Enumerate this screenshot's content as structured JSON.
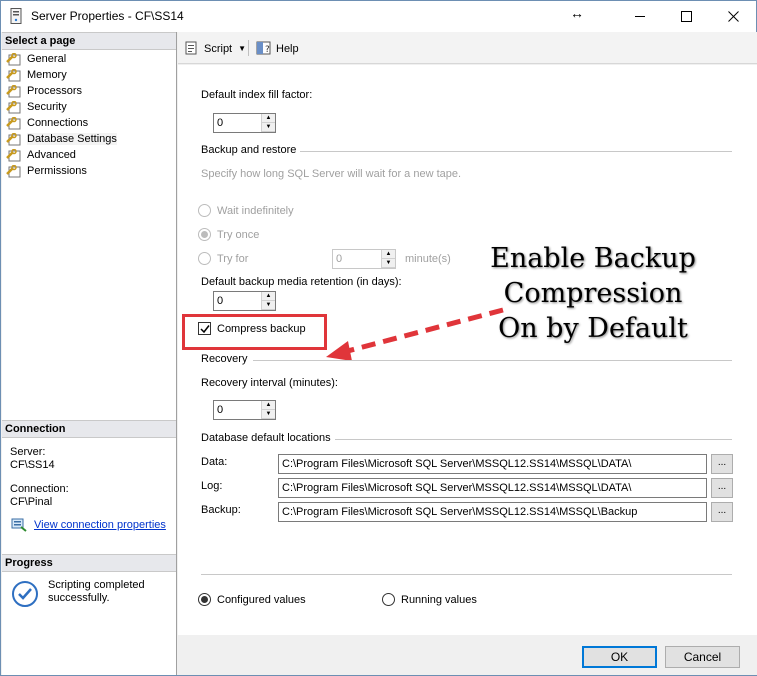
{
  "window": {
    "title": "Server Properties - CF\\SS14"
  },
  "left_pane": {
    "select_header": "Select a page",
    "pages": [
      {
        "label": "General"
      },
      {
        "label": "Memory"
      },
      {
        "label": "Processors"
      },
      {
        "label": "Security"
      },
      {
        "label": "Connections"
      },
      {
        "label": "Database Settings"
      },
      {
        "label": "Advanced"
      },
      {
        "label": "Permissions"
      }
    ],
    "connection_header": "Connection",
    "server_label": "Server:",
    "server_value": "CF\\SS14",
    "connection_label": "Connection:",
    "connection_value": "CF\\Pinal",
    "view_connection_link": "View connection properties",
    "progress_header": "Progress",
    "progress_line1": "Scripting completed",
    "progress_line2": "successfully."
  },
  "toolbar": {
    "script_label": "Script",
    "help_label": "Help"
  },
  "settings": {
    "fill_factor_label": "Default index fill factor:",
    "fill_factor_value": "0",
    "backup_group": "Backup and restore",
    "backup_hint": "Specify how long SQL Server will wait for a new tape.",
    "wait_indefinitely": "Wait indefinitely",
    "try_once": "Try once",
    "try_for": "Try for",
    "try_for_value": "0",
    "minutes_unit": "minute(s)",
    "retention_label": "Default backup media retention (in days):",
    "retention_value": "0",
    "compress_backup": "Compress backup",
    "recovery_group": "Recovery",
    "recovery_interval_label": "Recovery interval (minutes):",
    "recovery_interval_value": "0",
    "locations_group": "Database default locations",
    "data_label": "Data:",
    "data_path": "C:\\Program Files\\Microsoft SQL Server\\MSSQL12.SS14\\MSSQL\\DATA\\",
    "log_label": "Log:",
    "log_path": "C:\\Program Files\\Microsoft SQL Server\\MSSQL12.SS14\\MSSQL\\DATA\\",
    "backup_label": "Backup:",
    "backup_path": "C:\\Program Files\\Microsoft SQL Server\\MSSQL12.SS14\\MSSQL\\Backup",
    "browse_label": "...",
    "configured_values": "Configured values",
    "running_values": "Running values"
  },
  "annotation": {
    "line1": "Enable Backup",
    "line2": "Compression",
    "line3": "On by Default"
  },
  "footer": {
    "ok_label": "OK",
    "cancel_label": "Cancel"
  },
  "colors": {
    "highlight": "#e0353a",
    "link": "#0033cc"
  }
}
